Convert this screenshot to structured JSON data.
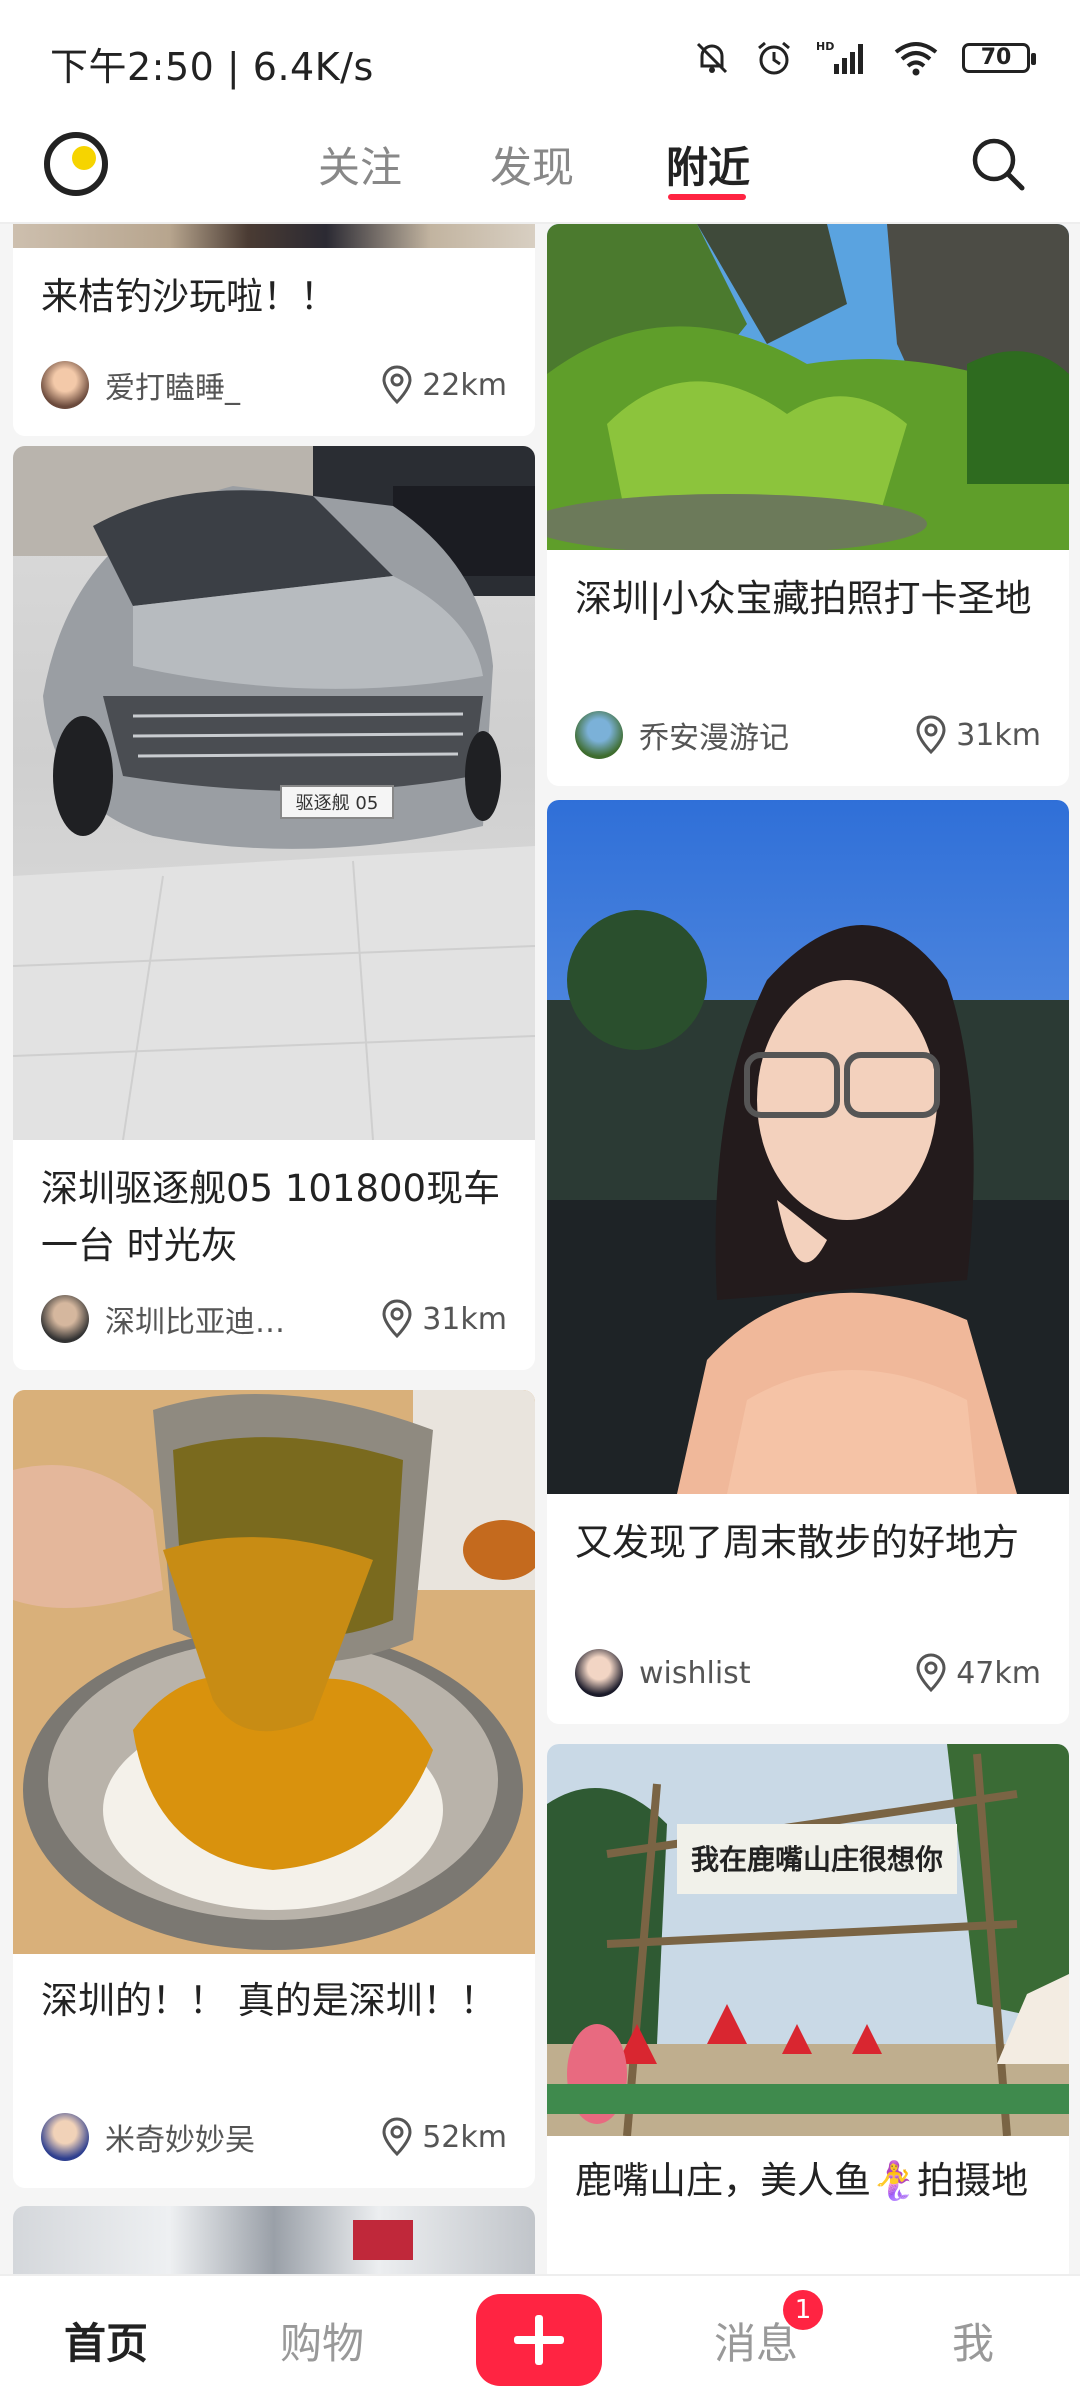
{
  "status_bar": {
    "time_speed": "下午2:50 | 6.4K/s",
    "battery": "70",
    "icons": [
      "mute-bell-icon",
      "alarm-icon",
      "hd-signal-icon",
      "wifi-icon",
      "battery-icon"
    ]
  },
  "top_nav": {
    "tabs": [
      {
        "label": "关注"
      },
      {
        "label": "发现"
      },
      {
        "label": "附近"
      }
    ],
    "active_tab": "附近",
    "icons": [
      "app-logo-icon",
      "search-icon"
    ]
  },
  "feed": {
    "left": [
      {
        "title": "来桔钓沙玩啦！！",
        "author": "爱打瞌睡_",
        "distance": "22km"
      },
      {
        "title": "深圳驱逐舰05 101800现车一台 时光灰",
        "author": "深圳比亚迪…",
        "distance": "31km",
        "image_plate_text": "驱逐舰 05"
      },
      {
        "title": "深圳的！！ 真的是深圳！！",
        "author": "米奇妙妙吴",
        "distance": "52km"
      }
    ],
    "right": [
      {
        "title": "深圳|小众宝藏拍照打卡圣地",
        "author": "乔安漫游记",
        "distance": "31km"
      },
      {
        "title": "又发现了周末散步的好地方",
        "author": "wishlist",
        "distance": "47km"
      },
      {
        "title": "鹿嘴山庄，美人鱼🧜‍♀️拍摄地",
        "sign_text": "我在鹿嘴山庄很想你"
      }
    ]
  },
  "bottom_bar": {
    "home": "首页",
    "shop": "购物",
    "messages": "消息",
    "me": "我",
    "message_badge": "1",
    "accent_color": "#ff2442"
  }
}
